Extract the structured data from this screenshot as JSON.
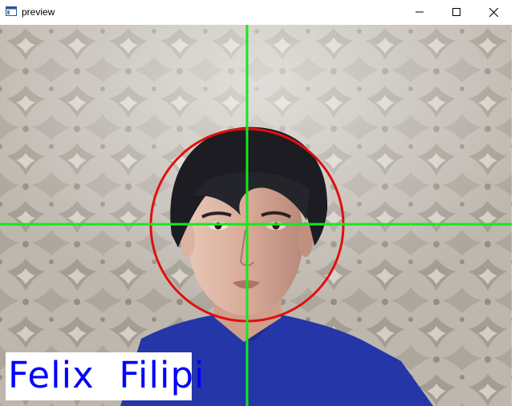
{
  "window": {
    "title": "preview",
    "app_icon": "window-app-icon",
    "controls": {
      "minimize_icon": "minimize-icon",
      "maximize_icon": "maximize-icon",
      "close_icon": "close-icon"
    }
  },
  "overlay": {
    "name_label": "Felix  Filipi",
    "name_color": "#0000ff",
    "crosshair_color": "#00ff00",
    "circle_color": "#ff0000"
  }
}
